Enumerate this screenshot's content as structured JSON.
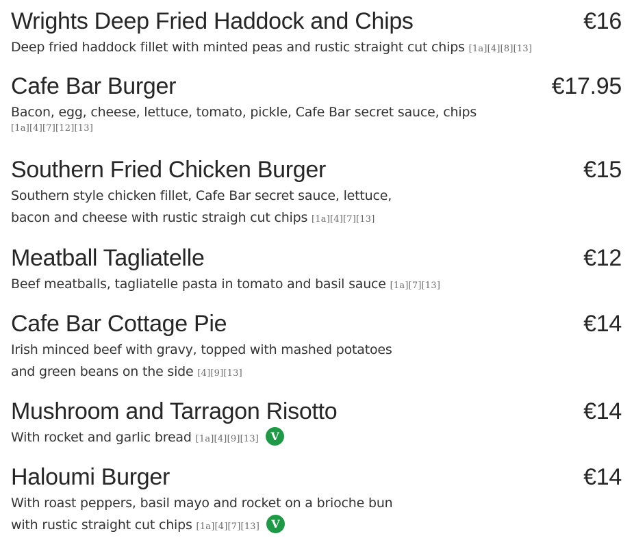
{
  "menu": {
    "items": [
      {
        "name": "Wrights Deep Fried Haddock and Chips",
        "price": "€16",
        "desc_lines": [
          "Deep fried haddock fillet with minted peas and rustic straight cut chips"
        ],
        "allergens": "[1a][4][8][13]",
        "vegetarian": false
      },
      {
        "name": "Cafe Bar Burger",
        "price": "€17.95",
        "desc_lines": [
          "Bacon, egg, cheese, lettuce, tomato, pickle, Cafe Bar secret sauce, chips"
        ],
        "allergens": "[1a][4][7][12][13]",
        "vegetarian": false
      },
      {
        "name": "Southern Fried Chicken Burger",
        "price": "€15",
        "desc_lines": [
          "Southern style chicken fillet, Cafe Bar secret sauce, lettuce,",
          "bacon and cheese with rustic straigh cut chips"
        ],
        "allergens": "[1a][4][7][13]",
        "vegetarian": false
      },
      {
        "name": "Meatball Tagliatelle",
        "price": "€12",
        "desc_lines": [
          "Beef meatballs, tagliatelle pasta in tomato and basil sauce"
        ],
        "allergens": "[1a][7][13]",
        "vegetarian": false
      },
      {
        "name": "Cafe Bar Cottage Pie",
        "price": "€14",
        "desc_lines": [
          "Irish minced beef with gravy, topped with mashed potatoes",
          "and green beans on the side"
        ],
        "allergens": "[4][9][13]",
        "vegetarian": false
      },
      {
        "name": "Mushroom and Tarragon Risotto",
        "price": "€14",
        "desc_lines": [
          "With rocket and garlic bread"
        ],
        "allergens": "[1a][4][9][13]",
        "vegetarian": true,
        "badge": "V"
      },
      {
        "name": "Haloumi Burger",
        "price": "€14",
        "desc_lines": [
          "With roast peppers, basil mayo and rocket on a brioche bun",
          "with rustic straight cut chips"
        ],
        "allergens": "[1a][4][7][13]",
        "vegetarian": true,
        "badge": "V"
      }
    ]
  },
  "colors": {
    "text": "#262626",
    "allergen_text": "#6b6b6b",
    "veg_badge": "#1e9a46"
  }
}
